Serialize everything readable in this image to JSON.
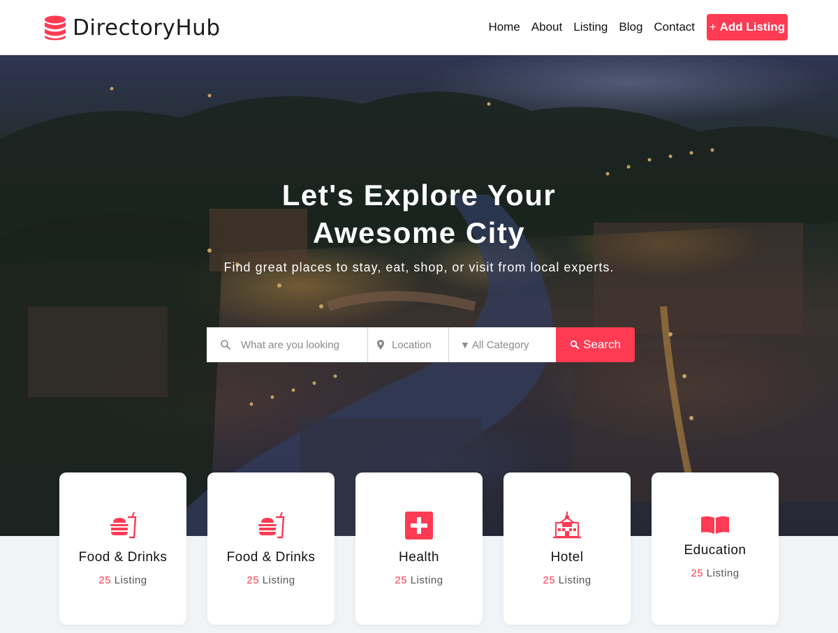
{
  "header": {
    "brand": "DirectoryHub",
    "nav": [
      {
        "label": "Home"
      },
      {
        "label": "About"
      },
      {
        "label": "Listing"
      },
      {
        "label": "Blog"
      },
      {
        "label": "Contact"
      }
    ],
    "add_button": {
      "prefix": "+",
      "label": "Add Listing"
    }
  },
  "hero": {
    "title_line1": "Let's Explore Your",
    "title_line2": "Awesome City",
    "subtitle": "Find great places to stay, eat, shop, or visit from local experts."
  },
  "search": {
    "keyword_placeholder": "What are you looking",
    "location_placeholder": "Location",
    "category_selected": "All Category",
    "button_label": "Search"
  },
  "categories": [
    {
      "name": "Food & Drinks",
      "count": "25",
      "unit": "Listing",
      "icon": "food-drinks-icon"
    },
    {
      "name": "Food & Drinks",
      "count": "25",
      "unit": "Listing",
      "icon": "food-drinks-icon"
    },
    {
      "name": "Health",
      "count": "25",
      "unit": "Listing",
      "icon": "health-cross-icon"
    },
    {
      "name": "Hotel",
      "count": "25",
      "unit": "Listing",
      "icon": "hotel-building-icon"
    },
    {
      "name": "Education",
      "count": "25",
      "unit": "Listing",
      "icon": "open-book-icon"
    }
  ],
  "colors": {
    "accent": "#fe3b53",
    "text_dark": "#111111",
    "page_background": "#f1f4f7"
  }
}
